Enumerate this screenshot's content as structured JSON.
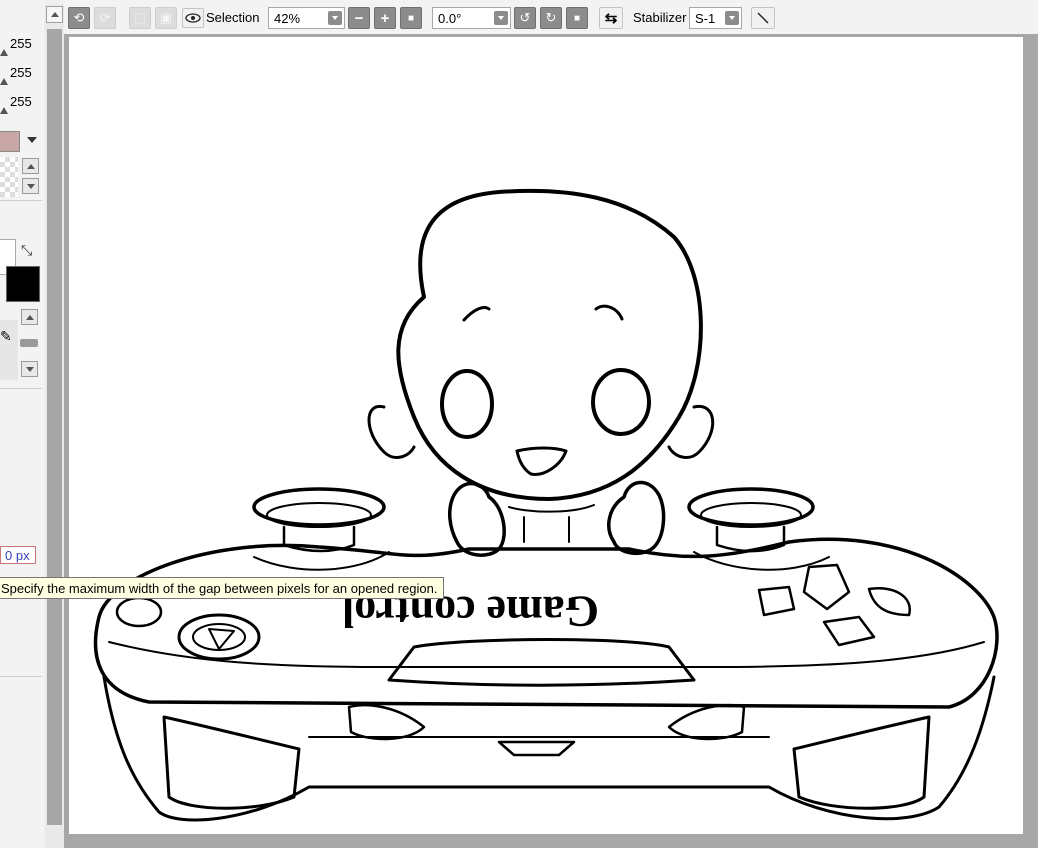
{
  "left_panel": {
    "rgb_values": [
      "255",
      "255",
      "255"
    ],
    "main_color": "#c8a6a6",
    "foreground_color": "#000000",
    "background_color": "#ffffff",
    "gap_value": "0 px"
  },
  "toolbar": {
    "selection_label": "Selection",
    "zoom_value": "42%",
    "rotation_value": "0.0°",
    "stabilizer_label": "Stabilizer",
    "stabilizer_value": "S-1"
  },
  "canvas": {
    "drawing_text": "Game control"
  },
  "tooltip": {
    "text": "Specify the maximum width of the gap between pixels for an opened region."
  },
  "icons": [
    "undo-icon",
    "redo-icon",
    "clear-selection-icon",
    "invert-selection-icon",
    "eye-icon",
    "zoom-out-icon",
    "zoom-in-icon",
    "zoom-reset-icon",
    "rotate-left-icon",
    "rotate-right-icon",
    "rotate-reset-icon",
    "flip-icon",
    "stabilizer-line-icon",
    "swap-colors-icon",
    "brush-icon"
  ]
}
